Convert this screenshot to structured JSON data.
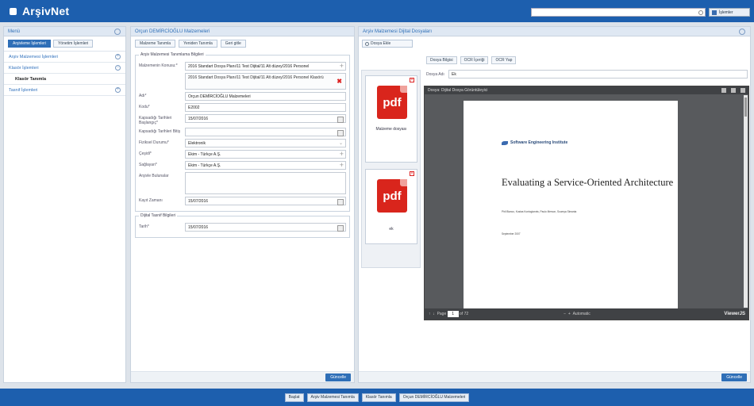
{
  "header": {
    "app_name": "ArşivNet",
    "search_placeholder": "",
    "user_label": "İşlemler"
  },
  "menu": {
    "title": "Menü",
    "tabs": [
      "Arşivleme İşlemleri",
      "Yönetim İşlemleri"
    ],
    "items": [
      {
        "label": "Arşiv Malzemesi İşlemleri"
      },
      {
        "label": "Klasör İşlemleri"
      },
      {
        "label": "Klasör Tanımla"
      },
      {
        "label": "Tasnif İşlemleri"
      }
    ]
  },
  "form": {
    "title": "Orçun DEMİRCİOĞLU Malzemeleri",
    "buttons": [
      "Malzeme Tanımla",
      "Yeniden Tanımla",
      "Geri gitle"
    ],
    "group1_legend": "Arşiv Malzemesi Tanımlama Bilgileri",
    "fields": {
      "malzeme_label": "Malzemenin Konusu:*",
      "malzeme_value": "2016 Standart Dosya Planı/11 Test Dijital/11 Alt düzey/2016 Personel",
      "malzeme_dropdown": "2016 Standart Dosya Planı/11 Test Dijital/11 Alt düzey/2016 Personel Klasörü",
      "adi_label": "Adı*",
      "adi_value": "Orçun DEMİRCİOĞLU Malzemeleri",
      "kodu_label": "Kodu*",
      "kodu_value": "E2002",
      "kapsadigi_baslangic_label": "Kapsadığı Tarihleri Başlangıç*",
      "kapsadigi_baslangic_value": "15/07/2016",
      "kapsadigi_bitis_label": "Kapsadığı Tarihleri Bitiş",
      "kapsadigi_bitis_value": "",
      "fiziksel_label": "Fiziksel Durumu*",
      "fiziksel_value": "Elektronik",
      "cesidi_label": "Çeşidi*",
      "cesidi_value": "Ekim - Türkçe A.Ş.",
      "saglayan_label": "Sağlayan*",
      "saglayan_value": "Ekim - Türkçe A.Ş.",
      "aciklama_label": "Arşivle Bulunalar",
      "kayit_label": "Kayıt Zamanı",
      "kayit_value": "15/07/2016"
    },
    "group2_legend": "Dijital Tasnif Bilgileri",
    "tarih_label": "Tarih*",
    "tarih_value": "15/07/2016",
    "save_label": "Güncelle"
  },
  "files": {
    "title": "Arşiv Malzemesi Dijital Dosyaları",
    "upload_label": "Dosya Ekle",
    "thumbs": [
      {
        "label": "pdf",
        "caption": "Malzeme dosyası"
      },
      {
        "label": "pdf",
        "caption": "ek"
      }
    ],
    "tabs": [
      "Dosya Bilgisi",
      "OCR İçeriği",
      "OCR Yap"
    ],
    "filename_label": "Dosya Adı",
    "filename_value": "Ek",
    "viewer": {
      "toolbar_text": "Dosya: Dijital Dosya Görüntüleyici",
      "sei_name": "Software Engineering Institute",
      "doc_title": "Evaluating a Service-Oriented Architecture",
      "authors": "Phil Bianco, Kostas Kontogiannis, Paulo Merson, Soumya Simanta",
      "date": "September 2007",
      "page_label": "Page",
      "page_num": "1",
      "page_total": "of 72",
      "zoom": "Automatic",
      "brand": "ViewerJS"
    },
    "save_label": "Güncelle"
  },
  "taskbar": [
    "Başlat",
    "Arşiv Malzemesi Tanımla",
    "Klasör Tanımla",
    "Orçun DEMİRCİOĞLU Malzemeleri"
  ]
}
